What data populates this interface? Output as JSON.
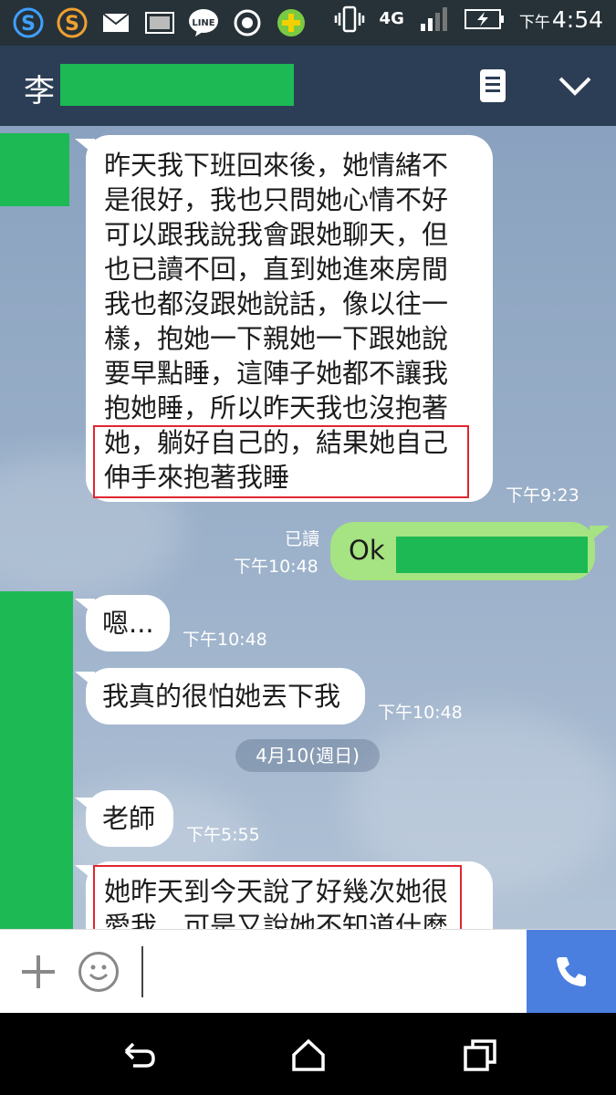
{
  "status_bar": {
    "network": "4G",
    "time_prefix": "下午",
    "time": "4:54",
    "icons": [
      "s-app-icon",
      "s-app-orange-icon",
      "mail-icon",
      "image-icon",
      "line-icon",
      "record-icon",
      "plus-app-icon",
      "vibrate-icon",
      "signal-icon",
      "battery-charging-icon"
    ]
  },
  "header": {
    "contact_initial": "李",
    "notes_icon": "notes-icon",
    "collapse_icon": "chevron-down-icon"
  },
  "messages": {
    "m1_lines": [
      "昨天我下班回來後，她情緒不",
      "是很好，我也只問她心情不好",
      "可以跟我說我會跟她聊天，但",
      "也已讀不回，直到她進來房間",
      "我也都沒跟她說話，像以往一",
      "樣，抱她一下親她一下跟她說",
      "要早點睡，這陣子她都不讓我",
      "抱她睡，所以昨天我也沒抱著",
      "她，躺好自己的，結果她自己",
      "伸手來抱著我睡"
    ],
    "m1_time": "下午9:23",
    "m2_text": "Ok",
    "m2_read": "已讀",
    "m2_time": "下午10:48",
    "m3_text": "嗯...",
    "m3_time": "下午10:48",
    "m4_text": "我真的很怕她丟下我",
    "m4_time": "下午10:48",
    "date_divider": "4月10(週日)",
    "m5_text": "老師",
    "m5_time": "下午5:55",
    "m6_lines": [
      "她昨天到今天說了好幾次她很",
      "愛我，可是又說她不知道什麼"
    ]
  },
  "colors": {
    "header_bg": "#2c3e55",
    "bubble_other": "#ffffff",
    "bubble_me": "#a6e382",
    "redaction": "#1db954",
    "highlight_box": "#e0262f",
    "call_button": "#4a7fe0"
  },
  "input_bar": {
    "plus_icon": "plus-icon",
    "emoji_icon": "emoji-icon",
    "call_icon": "phone-icon"
  },
  "nav": {
    "back_icon": "back-icon",
    "home_icon": "home-icon",
    "recent_icon": "recent-apps-icon"
  }
}
